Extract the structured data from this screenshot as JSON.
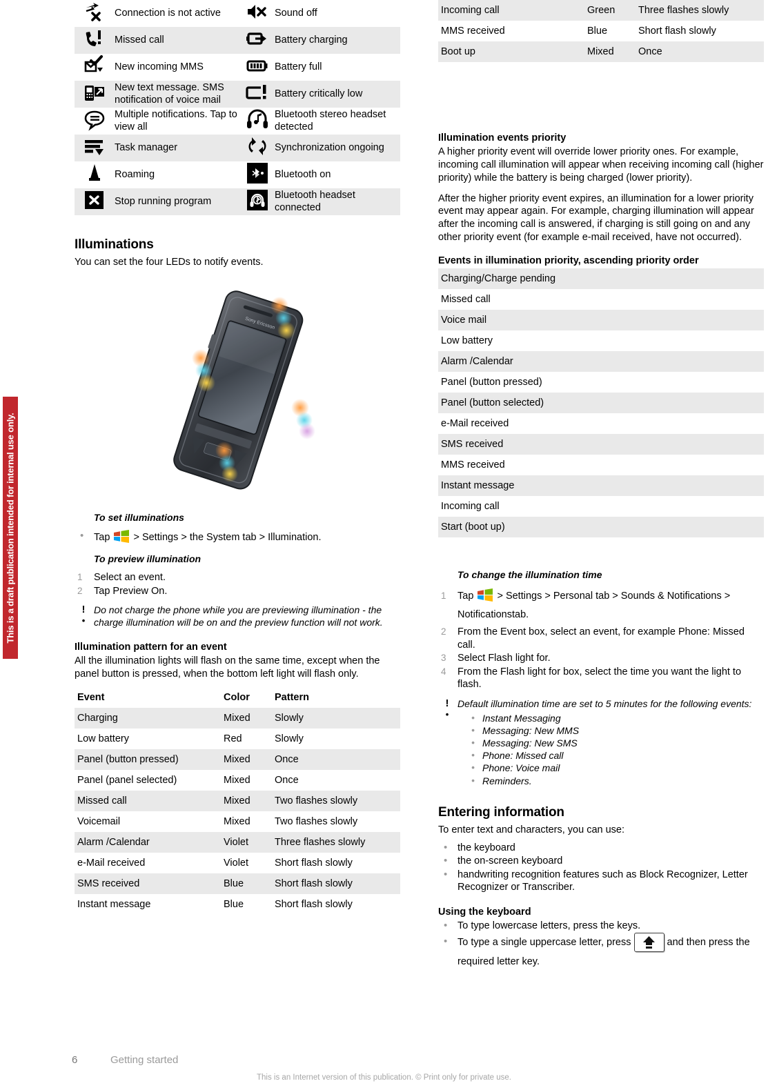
{
  "watermark": {
    "text": "This is a draft publication intended for internal use only."
  },
  "status_icons": {
    "rows": [
      {
        "shade": false,
        "left": {
          "icon": "connection-not-active-icon",
          "label": "Connection is not active"
        },
        "right": {
          "icon": "sound-off-icon",
          "label": "Sound off"
        }
      },
      {
        "shade": true,
        "left": {
          "icon": "missed-call-icon",
          "label": "Missed call"
        },
        "right": {
          "icon": "battery-charging-icon",
          "label": "Battery charging"
        }
      },
      {
        "shade": false,
        "left": {
          "icon": "new-incoming-mms-icon",
          "label": "New incoming MMS"
        },
        "right": {
          "icon": "battery-full-icon",
          "label": "Battery full"
        }
      },
      {
        "shade": true,
        "left": {
          "icon": "new-text-message-icon",
          "label": "New text message. SMS notification of voice mail"
        },
        "right": {
          "icon": "battery-critically-low-icon",
          "label": "Battery critically low"
        }
      },
      {
        "shade": false,
        "left": {
          "icon": "multiple-notifications-icon",
          "label": "Multiple notifications. Tap to view all"
        },
        "right": {
          "icon": "bluetooth-stereo-headset-icon",
          "label": "Bluetooth stereo headset detected"
        }
      },
      {
        "shade": true,
        "left": {
          "icon": "task-manager-icon",
          "label": "Task manager"
        },
        "right": {
          "icon": "synchronization-ongoing-icon",
          "label": "Synchronization ongoing"
        }
      },
      {
        "shade": false,
        "left": {
          "icon": "roaming-icon",
          "label": "Roaming"
        },
        "right": {
          "icon": "bluetooth-on-icon",
          "label": "Bluetooth on"
        }
      },
      {
        "shade": true,
        "left": {
          "icon": "stop-running-program-icon",
          "label": "Stop running program"
        },
        "right": {
          "icon": "bluetooth-headset-connected-icon",
          "label": "Bluetooth headset connected"
        }
      }
    ]
  },
  "illuminations": {
    "heading": "Illuminations",
    "intro": "You can set the four LEDs to notify events.",
    "phone_illustration": "phone-with-illumination-leds",
    "set_proc": {
      "title": "To set illuminations",
      "step_prefix": "Tap",
      "step_suffix": "> Settings > the System tab > Illumination."
    },
    "preview_proc": {
      "title": "To preview illumination",
      "steps": [
        "Select an event.",
        "Tap Preview On."
      ]
    },
    "preview_note": "Do not charge the phone while you are previewing illumination - the charge illumination will be on and the preview function will not work."
  },
  "pattern_section": {
    "heading": "Illumination pattern for an event",
    "intro": "All the illumination lights will flash on the same time, except when the panel button is pressed, when the bottom left light will flash only."
  },
  "pattern_table": {
    "columns": [
      "Event",
      "Color",
      "Pattern"
    ],
    "rows": [
      [
        "Charging",
        "Mixed",
        "Slowly"
      ],
      [
        "Low battery",
        "Red",
        "Slowly"
      ],
      [
        "Panel (button pressed)",
        "Mixed",
        "Once"
      ],
      [
        "Panel (panel selected)",
        "Mixed",
        "Once"
      ],
      [
        "Missed call",
        "Mixed",
        "Two flashes slowly"
      ],
      [
        "Voicemail",
        "Mixed",
        "Two flashes slowly"
      ],
      [
        "Alarm /Calendar",
        "Violet",
        "Three flashes slowly"
      ],
      [
        "e-Mail received",
        "Violet",
        "Short flash slowly"
      ],
      [
        "SMS received",
        "Blue",
        "Short flash slowly"
      ],
      [
        "Instant message",
        "Blue",
        "Short flash slowly"
      ]
    ],
    "continued_rows": [
      [
        "Incoming call",
        "Green",
        "Three flashes slowly"
      ],
      [
        "MMS received",
        "Blue",
        "Short flash slowly"
      ],
      [
        "Boot up",
        "Mixed",
        "Once"
      ]
    ]
  },
  "priority_section": {
    "heading": "Illumination events priority",
    "para1": "A higher priority event will override lower priority ones. For example, incoming call illumination will appear when receiving incoming call (higher priority) while the battery is being charged (lower priority).",
    "para2": "After the higher priority event expires, an illumination for a lower priority event may appear again. For example, charging illumination will appear after the incoming call is answered, if charging is still going on and any other priority event (for example e-mail received, have not occurred)."
  },
  "priority_list": {
    "title": "Events in illumination priority, ascending priority order",
    "items": [
      "Charging/Charge pending",
      "Missed call",
      "Voice mail",
      "Low battery",
      "Alarm /Calendar",
      "Panel (button pressed)",
      "Panel (button selected)",
      "e-Mail received",
      "SMS received",
      "MMS received",
      "Instant message",
      "Incoming call",
      "Start (boot up)"
    ]
  },
  "change_time_proc": {
    "title": "To change the illumination time",
    "step1_prefix": "Tap",
    "step1_suffix": "> Settings > Personal tab > Sounds & Notifications > Notificationstab.",
    "steps_rest": [
      "From the Event box, select an event, for example Phone: Missed call.",
      "Select Flash light for.",
      "From the Flash light for box, select the time you want the light to flash."
    ],
    "note": "Default illumination time are set to 5 minutes for the following events:",
    "note_items": [
      "Instant Messaging",
      "Messaging: New MMS",
      "Messaging: New SMS",
      "Phone: Missed call",
      "Phone: Voice mail",
      "Reminders."
    ]
  },
  "entering_information": {
    "heading": "Entering information",
    "intro": "To enter text and characters, you can use:",
    "items": [
      "the keyboard",
      "the on-screen keyboard",
      "handwriting recognition features such as Block Recognizer, Letter Recognizer or Transcriber."
    ]
  },
  "using_keyboard": {
    "heading": "Using the keyboard",
    "item1": "To type lowercase letters, press the keys.",
    "item2_prefix": "To type a single uppercase letter, press",
    "item2_suffix": "and then press the required letter key.",
    "shift_key_icon": "shift-key-icon"
  },
  "footer": {
    "page_number": "6",
    "breadcrumb": "Getting started",
    "legal": "This is an Internet version of this publication. © Print only for private use."
  }
}
